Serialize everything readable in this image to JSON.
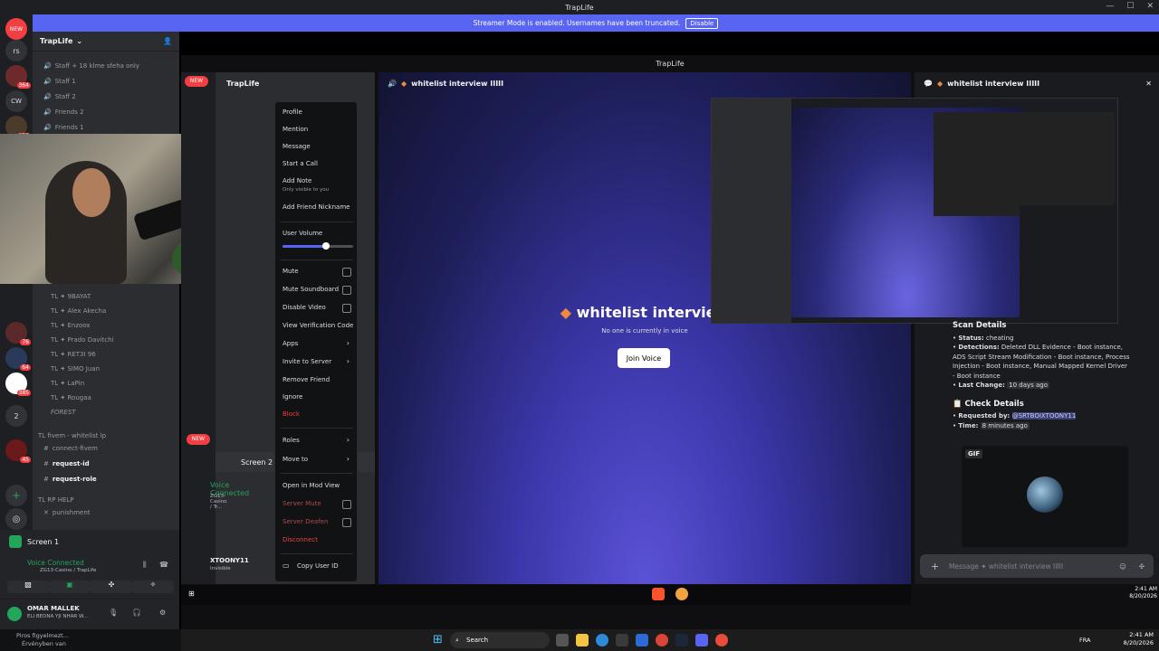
{
  "window": {
    "title": "TrapLife",
    "inner_title": "TrapLife"
  },
  "banner": {
    "text": "Streamer Mode is enabled. Usernames have been truncated.",
    "button": "Disable"
  },
  "guild_list": {
    "items": [
      {
        "label": "NEW",
        "badge": ""
      },
      {
        "label": "rs",
        "badge": ""
      },
      {
        "label": "",
        "badge": "364"
      },
      {
        "label": "CW",
        "badge": ""
      },
      {
        "label": "",
        "badge": "116"
      },
      {
        "label": "",
        "badge": "76"
      },
      {
        "label": "",
        "badge": "64"
      },
      {
        "label": "",
        "badge": "385"
      },
      {
        "label": "2",
        "badge": ""
      },
      {
        "label": "",
        "badge": "45"
      }
    ]
  },
  "server": {
    "name": "TrapLife"
  },
  "channels": {
    "top": [
      "Staff + 18 klme sfeha only",
      "Staff 1",
      "Staff 2",
      "Friends 2",
      "Friends 1"
    ],
    "voice_users": [
      "TL ✦ 9BAYAT",
      "TL ✦ Alex Akecha",
      "TL ✦ Enzoox",
      "TL ✦ Prado Davitchi",
      "TL ✦ RET3I 96",
      "TL ✦ SIMO Juan",
      "TL ✦ LaPin",
      "TL ✦ Rougaa",
      "FOREST"
    ],
    "cat_fivem": "TL fivem - whitelist lp",
    "fivem_channels": [
      "connect-fivem",
      "request-id",
      "request-role"
    ],
    "cat_rphelp": "TL RP HELP",
    "rp_channels": [
      "punishment"
    ]
  },
  "voice": {
    "screen_label": "Screen 1",
    "status": "Voice Connected",
    "location": "ZG13-Casino / TrapLife",
    "user_name": "OMAR MALLEK",
    "user_status": "ELI BEDNA YJI NHAR W..."
  },
  "notification": {
    "title": "Piros figyelmezt...",
    "subtitle": "Érvényben van"
  },
  "inner": {
    "server_name": "TrapLife",
    "screen_label": "Screen 2",
    "voice_status": "Voice Connected",
    "voice_location": "ZG13-Casino / Tr...",
    "user_name": "XTOONY11",
    "user_status": "Invisible"
  },
  "stage": {
    "channel": "whitelist interview IIIII",
    "title": "whitelist interview",
    "subtitle": "No one is currently in voice",
    "join_button": "Join Voice"
  },
  "side_chat": {
    "channel": "whitelist interview IIIII"
  },
  "scan": {
    "header": "Scan Details",
    "status_label": "Status:",
    "status_value": "cheating",
    "detections_label": "Detections:",
    "detections_value": "Deleted DLL Evidence - Boot instance, ADS Script Stream Modification - Boot instance, Process Injection - Boot instance, Manual Mapped Kernel Driver - Boot instance",
    "last_change_label": "Last Change:",
    "last_change_value": "10 days ago",
    "check_header": "Check Details",
    "requested_label": "Requested by:",
    "requested_value": "@SRTBOIXTOONY11",
    "time_label": "Time:",
    "time_value": "8 minutes ago",
    "gif_label": "GIF"
  },
  "message_box": {
    "placeholder": "Message ✦ whitelist interview IIIII"
  },
  "context_menu": {
    "items": {
      "profile": "Profile",
      "mention": "Mention",
      "message": "Message",
      "start_call": "Start a Call",
      "add_note": "Add Note",
      "add_note_sub": "Only visible to you",
      "add_nickname": "Add Friend Nickname",
      "user_volume": "User Volume",
      "mute": "Mute",
      "mute_soundboard": "Mute Soundboard",
      "disable_video": "Disable Video",
      "view_verification": "View Verification Code",
      "apps": "Apps",
      "invite": "Invite to Server",
      "remove_friend": "Remove Friend",
      "ignore": "Ignore",
      "block": "Block",
      "roles": "Roles",
      "move_to": "Move to",
      "mod_view": "Open in Mod View",
      "server_mute": "Server Mute",
      "server_deafen": "Server Deafen",
      "disconnect": "Disconnect",
      "copy_id": "Copy User ID"
    },
    "volume_level": 0.62
  },
  "taskbar": {
    "search": "Search",
    "lang": "FRA",
    "time": "2:41 AM",
    "date": "8/20/2026"
  },
  "inner_taskbar": {
    "time": "2:41 AM",
    "date": "8/20/2026"
  }
}
